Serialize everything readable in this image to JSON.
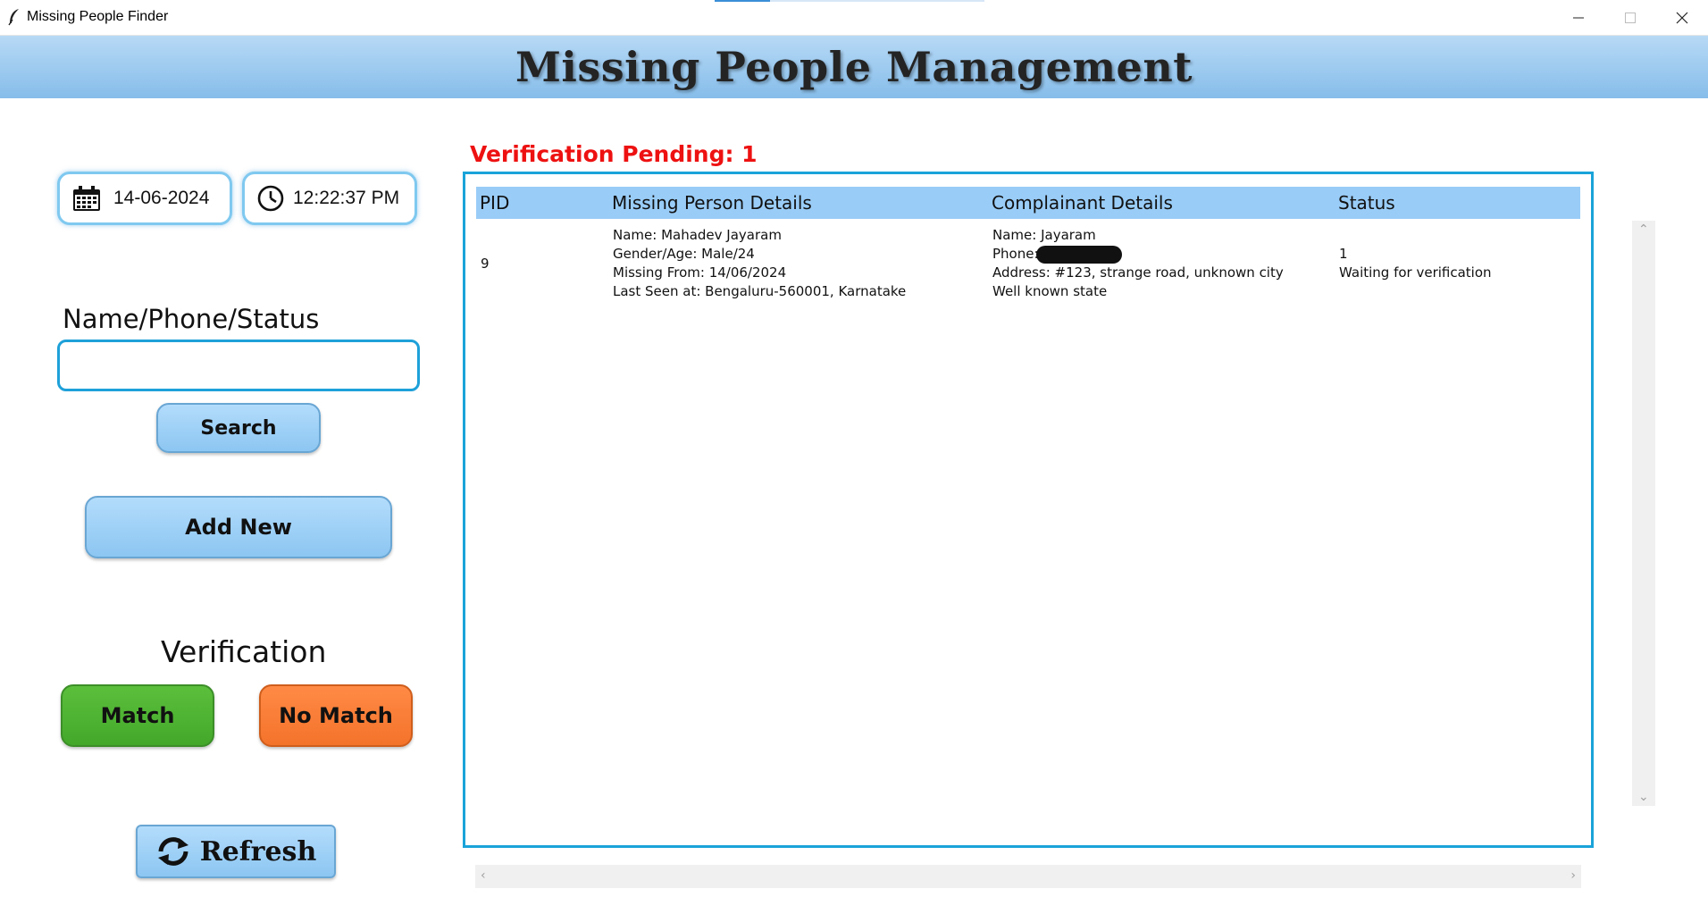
{
  "window": {
    "title": "Missing People Finder"
  },
  "header": {
    "title": "Missing People Management"
  },
  "left_panel": {
    "date": "14-06-2024",
    "time": "12:22:37 PM",
    "search_label": "Name/Phone/Status",
    "search_value": "",
    "search_button": "Search",
    "add_button": "Add New",
    "verification_title": "Verification",
    "match_button": "Match",
    "no_match_button": "No Match",
    "refresh_button": "Refresh"
  },
  "right_panel": {
    "pending_text": "Verification Pending: 1",
    "columns": [
      "PID",
      "Missing Person Details",
      "Complainant Details",
      "Status"
    ],
    "rows": [
      {
        "pid": "9",
        "missing_person": [
          "Name: Mahadev Jayaram",
          "Gender/Age: Male/24",
          "Missing From: 14/06/2024",
          "Last Seen at: Bengaluru-560001, Karnatake"
        ],
        "complainant": [
          "Name: Jayaram",
          "Phone:",
          "Address: #123, strange road, unknown city",
          "Well known state"
        ],
        "status": [
          "1",
          "Waiting for verification"
        ]
      }
    ]
  },
  "colors": {
    "header_gradient_top": "#b7d9f5",
    "header_gradient_bottom": "#86bdea",
    "table_border": "#1aa3d9",
    "table_header": "#99ccf7",
    "pending": "#ee1111",
    "match": "#4cb233",
    "no_match": "#f77b35",
    "button_blue": "#9fd0f6"
  },
  "icons": [
    "feather-icon",
    "calendar-icon",
    "clock-icon",
    "refresh-icon",
    "minimize-icon",
    "maximize-icon",
    "close-icon"
  ]
}
